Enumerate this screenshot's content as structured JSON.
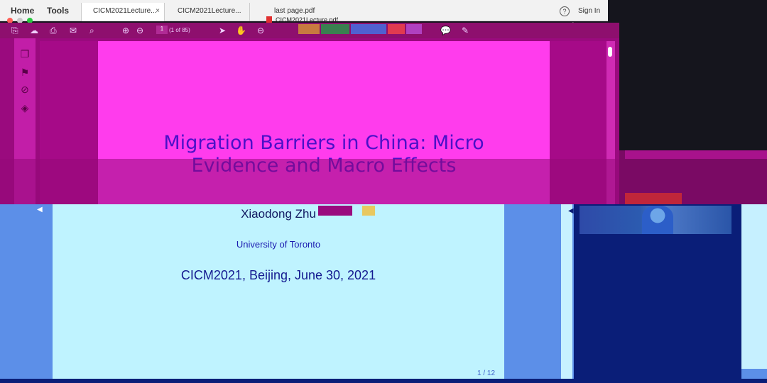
{
  "menubar": {
    "home": "Home",
    "tools": "Tools",
    "help": "?",
    "sign_in": "Sign In"
  },
  "tabs": [
    {
      "label": "CICM2021Lecture...",
      "close": "×"
    },
    {
      "label": "CICM2021Lecture..."
    },
    {
      "label": "last page.pdf"
    }
  ],
  "window_title": "CICM2021Lecture.pdf",
  "toolbar": {
    "page_input": "1",
    "page_count": "(1 of 85)"
  },
  "slide": {
    "title_line1": "Migration Barriers in China: Micro",
    "title_line2": "Evidence and Macro Effects",
    "author": "Xiaodong Zhu",
    "affiliation": "University of Toronto",
    "conference": "CICM2021, Beijing, June 30, 2021",
    "page_number": "1 / 12"
  },
  "colors": {
    "magenta_page": "#ff3ced",
    "magenta_dark": "#9a0a7e",
    "light_cyan_page": "#bff3ff",
    "blue_bg": "#5c8fe8",
    "navy_panel": "#0a1e78"
  }
}
